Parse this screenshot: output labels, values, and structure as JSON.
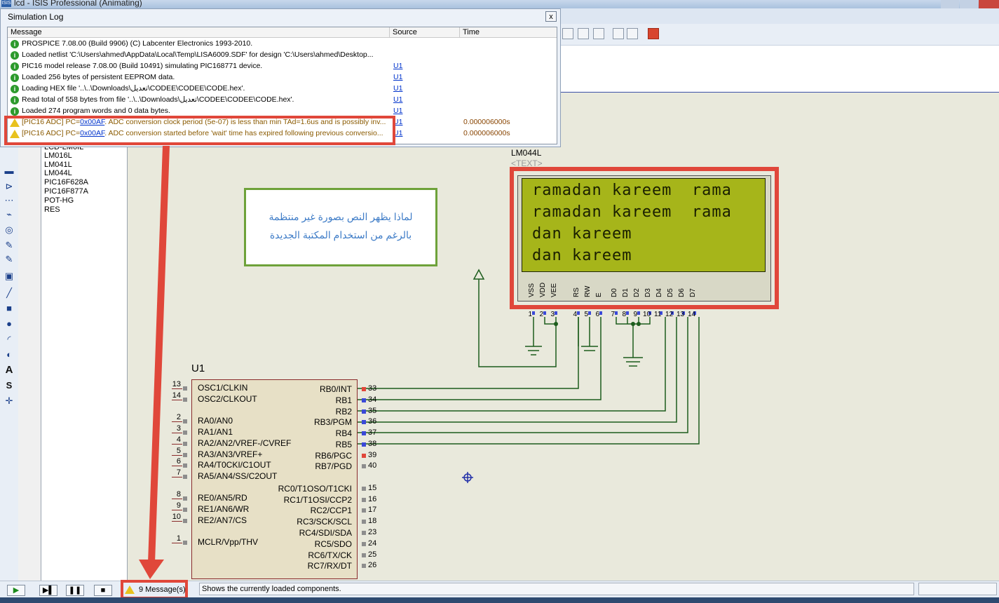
{
  "app": {
    "title": "lcd - ISIS Professional (Animating)",
    "logo_text": "ISIS"
  },
  "simlog": {
    "title": "Simulation Log",
    "close_label": "x",
    "columns": {
      "message": "Message",
      "source": "Source",
      "time": "Time"
    },
    "rows": [
      {
        "type": "info",
        "msg": "PROSPICE 7.08.00 (Build 9906) (C) Labcenter Electronics 1993-2010.",
        "src": "",
        "time": ""
      },
      {
        "type": "info",
        "msg": "Loaded netlist 'C:\\Users\\ahmed\\AppData\\Local\\Temp\\LISA6009.SDF' for design 'C:\\Users\\ahmed\\Desktop...",
        "src": "",
        "time": ""
      },
      {
        "type": "info",
        "msg": "PIC16 model release 7.08.00 (Build 10491) simulating PIC168771 device.",
        "src": "U1",
        "time": ""
      },
      {
        "type": "info",
        "msg": "Loaded 256 bytes of persistent EEPROM data.",
        "src": "U1",
        "time": ""
      },
      {
        "type": "info",
        "msg": "Loading HEX file '..\\..\\Downloads\\تعديل\\CODEE\\CODEE\\CODE.hex'.",
        "src": "U1",
        "time": ""
      },
      {
        "type": "info",
        "msg": "Read total of 558 bytes from file '..\\..\\Downloads\\تعديل\\CODEE\\CODEE\\CODE.hex'.",
        "src": "U1",
        "time": ""
      },
      {
        "type": "info",
        "msg": "Loaded 274 program words and 0 data bytes.",
        "src": "U1",
        "time": ""
      },
      {
        "type": "warn",
        "prefix": "[PIC16 ADC] PC=",
        "pc": "0x00AF",
        "msg": ". ADC conversion clock period (5e-07) is less than min TAd=1.6us and is possibly inv...",
        "src": "U1",
        "time": "0.000006000s"
      },
      {
        "type": "warn",
        "prefix": "[PIC16 ADC] PC=",
        "pc": "0x00AF",
        "msg": ". ADC conversion started before 'wait' time has expired following previous conversio...",
        "src": "U1",
        "time": "0.000006000s"
      }
    ]
  },
  "devices": [
    "LCD-LM0IL",
    "LM016L",
    "LM041L",
    "LM044L",
    "PIC16F628A",
    "PIC16F877A",
    "POT-HG",
    "RES"
  ],
  "lcd": {
    "part": "LM044L",
    "text_placeholder": "<TEXT>",
    "lines": [
      "ramadan kareem  rama",
      "ramadan kareem  rama",
      "dan kareem",
      "dan kareem"
    ],
    "pins": [
      "VSS",
      "VDD",
      "VEE",
      "RS",
      "RW",
      "E",
      "D0",
      "D1",
      "D2",
      "D3",
      "D4",
      "D5",
      "D6",
      "D7"
    ],
    "pin_numbers": [
      "1",
      "2",
      "3",
      "4",
      "5",
      "6",
      "7",
      "8",
      "9",
      "10",
      "11",
      "12",
      "13",
      "14"
    ]
  },
  "note": {
    "line1": "لماذا يظهر النص بصورة غير منتظمة",
    "line2": "بالرغم من استخدام المكتبة الجديدة"
  },
  "mcu": {
    "ref": "U1",
    "left_pins": [
      {
        "num": "13",
        "name": "OSC1/CLKIN"
      },
      {
        "num": "14",
        "name": "OSC2/CLKOUT"
      },
      {
        "num": "2",
        "name": "RA0/AN0"
      },
      {
        "num": "3",
        "name": "RA1/AN1"
      },
      {
        "num": "4",
        "name": "RA2/AN2/VREF-/CVREF"
      },
      {
        "num": "5",
        "name": "RA3/AN3/VREF+"
      },
      {
        "num": "6",
        "name": "RA4/T0CKI/C1OUT"
      },
      {
        "num": "7",
        "name": "RA5/AN4/SS/C2OUT"
      },
      {
        "num": "8",
        "name": "RE0/AN5/RD"
      },
      {
        "num": "9",
        "name": "RE1/AN6/WR"
      },
      {
        "num": "10",
        "name": "RE2/AN7/CS"
      },
      {
        "num": "1",
        "name": "MCLR/Vpp/THV"
      }
    ],
    "right_pins": [
      {
        "num": "33",
        "name": "RB0/INT"
      },
      {
        "num": "34",
        "name": "RB1"
      },
      {
        "num": "35",
        "name": "RB2"
      },
      {
        "num": "36",
        "name": "RB3/PGM"
      },
      {
        "num": "37",
        "name": "RB4"
      },
      {
        "num": "38",
        "name": "RB5"
      },
      {
        "num": "39",
        "name": "RB6/PGC"
      },
      {
        "num": "40",
        "name": "RB7/PGD"
      },
      {
        "num": "15",
        "name": "RC0/T1OSO/T1CKI"
      },
      {
        "num": "16",
        "name": "RC1/T1OSI/CCP2"
      },
      {
        "num": "17",
        "name": "RC2/CCP1"
      },
      {
        "num": "18",
        "name": "RC3/SCK/SCL"
      },
      {
        "num": "23",
        "name": "RC4/SDI/SDA"
      },
      {
        "num": "24",
        "name": "RC5/SDO"
      },
      {
        "num": "25",
        "name": "RC6/TX/CK"
      },
      {
        "num": "26",
        "name": "RC7/RX/DT"
      }
    ]
  },
  "statusbar": {
    "messages": "9 Message(s)",
    "status_text": "Shows the currently loaded components."
  },
  "colors": {
    "annotation_red": "#e0473a",
    "lcd_green": "#a6b51a",
    "note_border": "#6ea23a",
    "wire": "#1c5c1c"
  }
}
